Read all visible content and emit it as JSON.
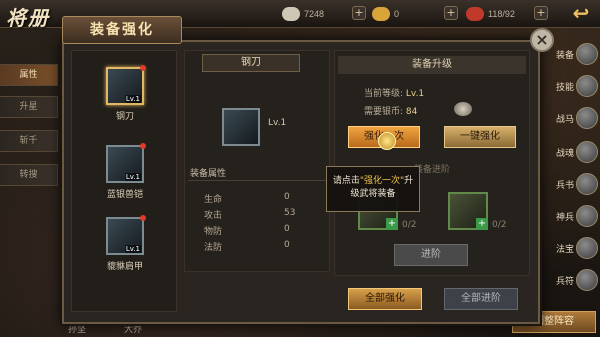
{
  "page": {
    "title": "将册",
    "modal_title": "装备强化"
  },
  "resources": [
    {
      "name": "coin",
      "value": "7248",
      "color": "#cfc7b6"
    },
    {
      "name": "ingot",
      "value": "0",
      "color": "#d9a43a"
    },
    {
      "name": "stamina",
      "value": "118/92",
      "color": "#c0392b"
    }
  ],
  "side_tabs": [
    "属性",
    "升星",
    "斩千",
    "转搜"
  ],
  "right_menu": [
    "装备",
    "技能",
    "战马",
    "战魂",
    "兵书",
    "神兵",
    "法宝",
    "兵符"
  ],
  "bottom_names": [
    "孙坚",
    "大乔"
  ],
  "bottom_button": "调整阵容",
  "equipment": [
    {
      "name": "钢刀",
      "level": "Lv.1"
    },
    {
      "name": "蓝银兽铠",
      "level": "Lv.1"
    },
    {
      "name": "貔貅肩甲",
      "level": "Lv.1"
    }
  ],
  "detail": {
    "name": "钢刀",
    "level": "Lv.1",
    "attr_title": "装备属性",
    "attributes": [
      {
        "label": "生命",
        "value": "0"
      },
      {
        "label": "攻击",
        "value": "53"
      },
      {
        "label": "物防",
        "value": "0"
      },
      {
        "label": "法防",
        "value": "0"
      }
    ]
  },
  "upgrade": {
    "title": "装备升级",
    "current_level_label": "当前等级:",
    "current_level": "Lv.1",
    "cost_label": "需要银币:",
    "cost": "84",
    "btn_upgrade": "强化一次",
    "btn_onekey": "一键强化",
    "advance_title": "装备进阶",
    "mat1": "0/2",
    "mat2": "0/2",
    "btn_advance": "进阶",
    "btn_all_upgrade": "全部强化",
    "btn_all_advance": "全部进阶"
  },
  "tooltip": {
    "pre": "请点击",
    "highlight": "\"强化一次\"",
    "post": "升级武将装备"
  },
  "icons": {
    "close": "×",
    "back": "↩",
    "plus": "+"
  }
}
